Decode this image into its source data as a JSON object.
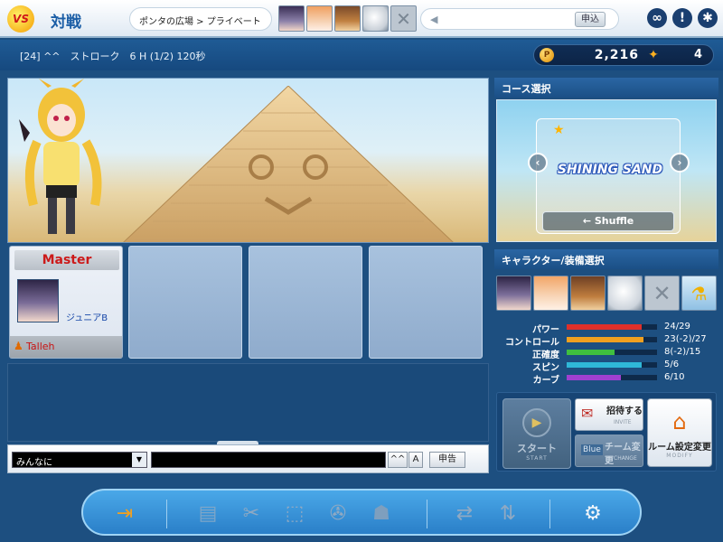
{
  "header": {
    "logo_text": "VS",
    "mode_title": "対戦",
    "room_path": "ポンタの広場 > プライベート",
    "volume_apply_label": "申込",
    "icons": [
      "community-icon",
      "help-icon",
      "settings-icon"
    ]
  },
  "room_info": {
    "text": "[24] ^^　ストローク　6 H (1/2)  120秒"
  },
  "currency": {
    "money": "2,216",
    "gems": "4",
    "coin_symbol": "P"
  },
  "slots": {
    "master_label": "Master",
    "master_char_name": "ジュニアB",
    "master_player_name": "Talleh"
  },
  "chat": {
    "channel": "みんなに",
    "emote_btn": "^^",
    "font_btn": "A",
    "report_btn": "申告"
  },
  "course": {
    "header": "コース選択",
    "name": "SHINING SAND",
    "shuffle_label": "Shuffle"
  },
  "character": {
    "header": "キャラクター/装備選択",
    "stats": [
      {
        "label": "パワー",
        "value": "24/29",
        "fill": 0.83,
        "color": "#e0302a"
      },
      {
        "label": "コントロール",
        "value": "23(-2)/27",
        "fill": 0.85,
        "color": "#f0a020"
      },
      {
        "label": "正確度",
        "value": "8(-2)/15",
        "fill": 0.53,
        "color": "#3fbf3f"
      },
      {
        "label": "スピン",
        "value": "5/6",
        "fill": 0.83,
        "color": "#2fb8d8"
      },
      {
        "label": "カーブ",
        "value": "6/10",
        "fill": 0.6,
        "color": "#a040d0"
      }
    ]
  },
  "actions": {
    "start_main": "スタート",
    "start_sub": "START",
    "invite_main": "招待する",
    "invite_sub": "INVITE",
    "team_main": "チーム変更",
    "team_sub": "CHANGE",
    "modify_main": "ルーム設定変更",
    "modify_sub": "MODIFY"
  },
  "dock": {
    "items": [
      "exit-icon",
      "card-icon",
      "scroll-icon",
      "gift-icon",
      "gear-trade-icon",
      "bag-icon",
      "swap-icon",
      "arrows-icon",
      "plugin-icon"
    ]
  }
}
